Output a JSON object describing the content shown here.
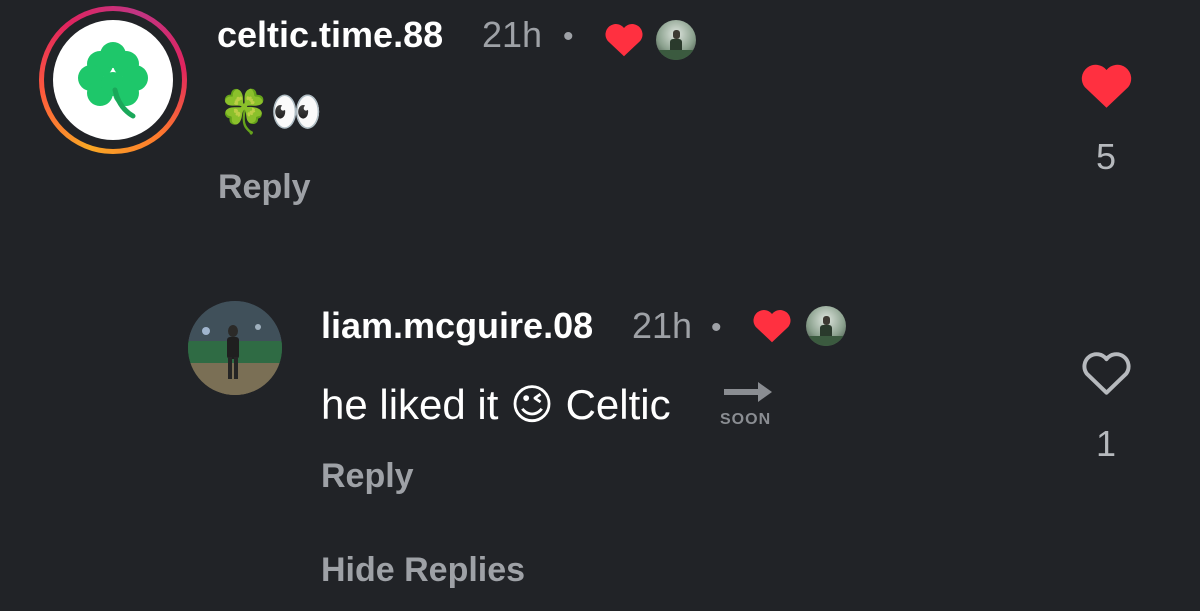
{
  "comments": [
    {
      "username": "celtic.time.88",
      "time": "21h",
      "separator": "•",
      "body": "🍀👀",
      "reply_label": "Reply",
      "like_count": "5",
      "liked": true,
      "avatar_icon": "shamrock-icon"
    },
    {
      "username": "liam.mcguire.08",
      "time": "21h",
      "separator": "•",
      "body_text": "he liked it",
      "body_emoji": "😉",
      "body_word": "Celtic",
      "soon_label": "SOON",
      "reply_label": "Reply",
      "like_count": "1",
      "liked": false
    }
  ],
  "hide_replies_label": "Hide Replies",
  "colors": {
    "background": "#212327",
    "like_red": "#ff3040",
    "muted_text": "#9ea1a6"
  }
}
